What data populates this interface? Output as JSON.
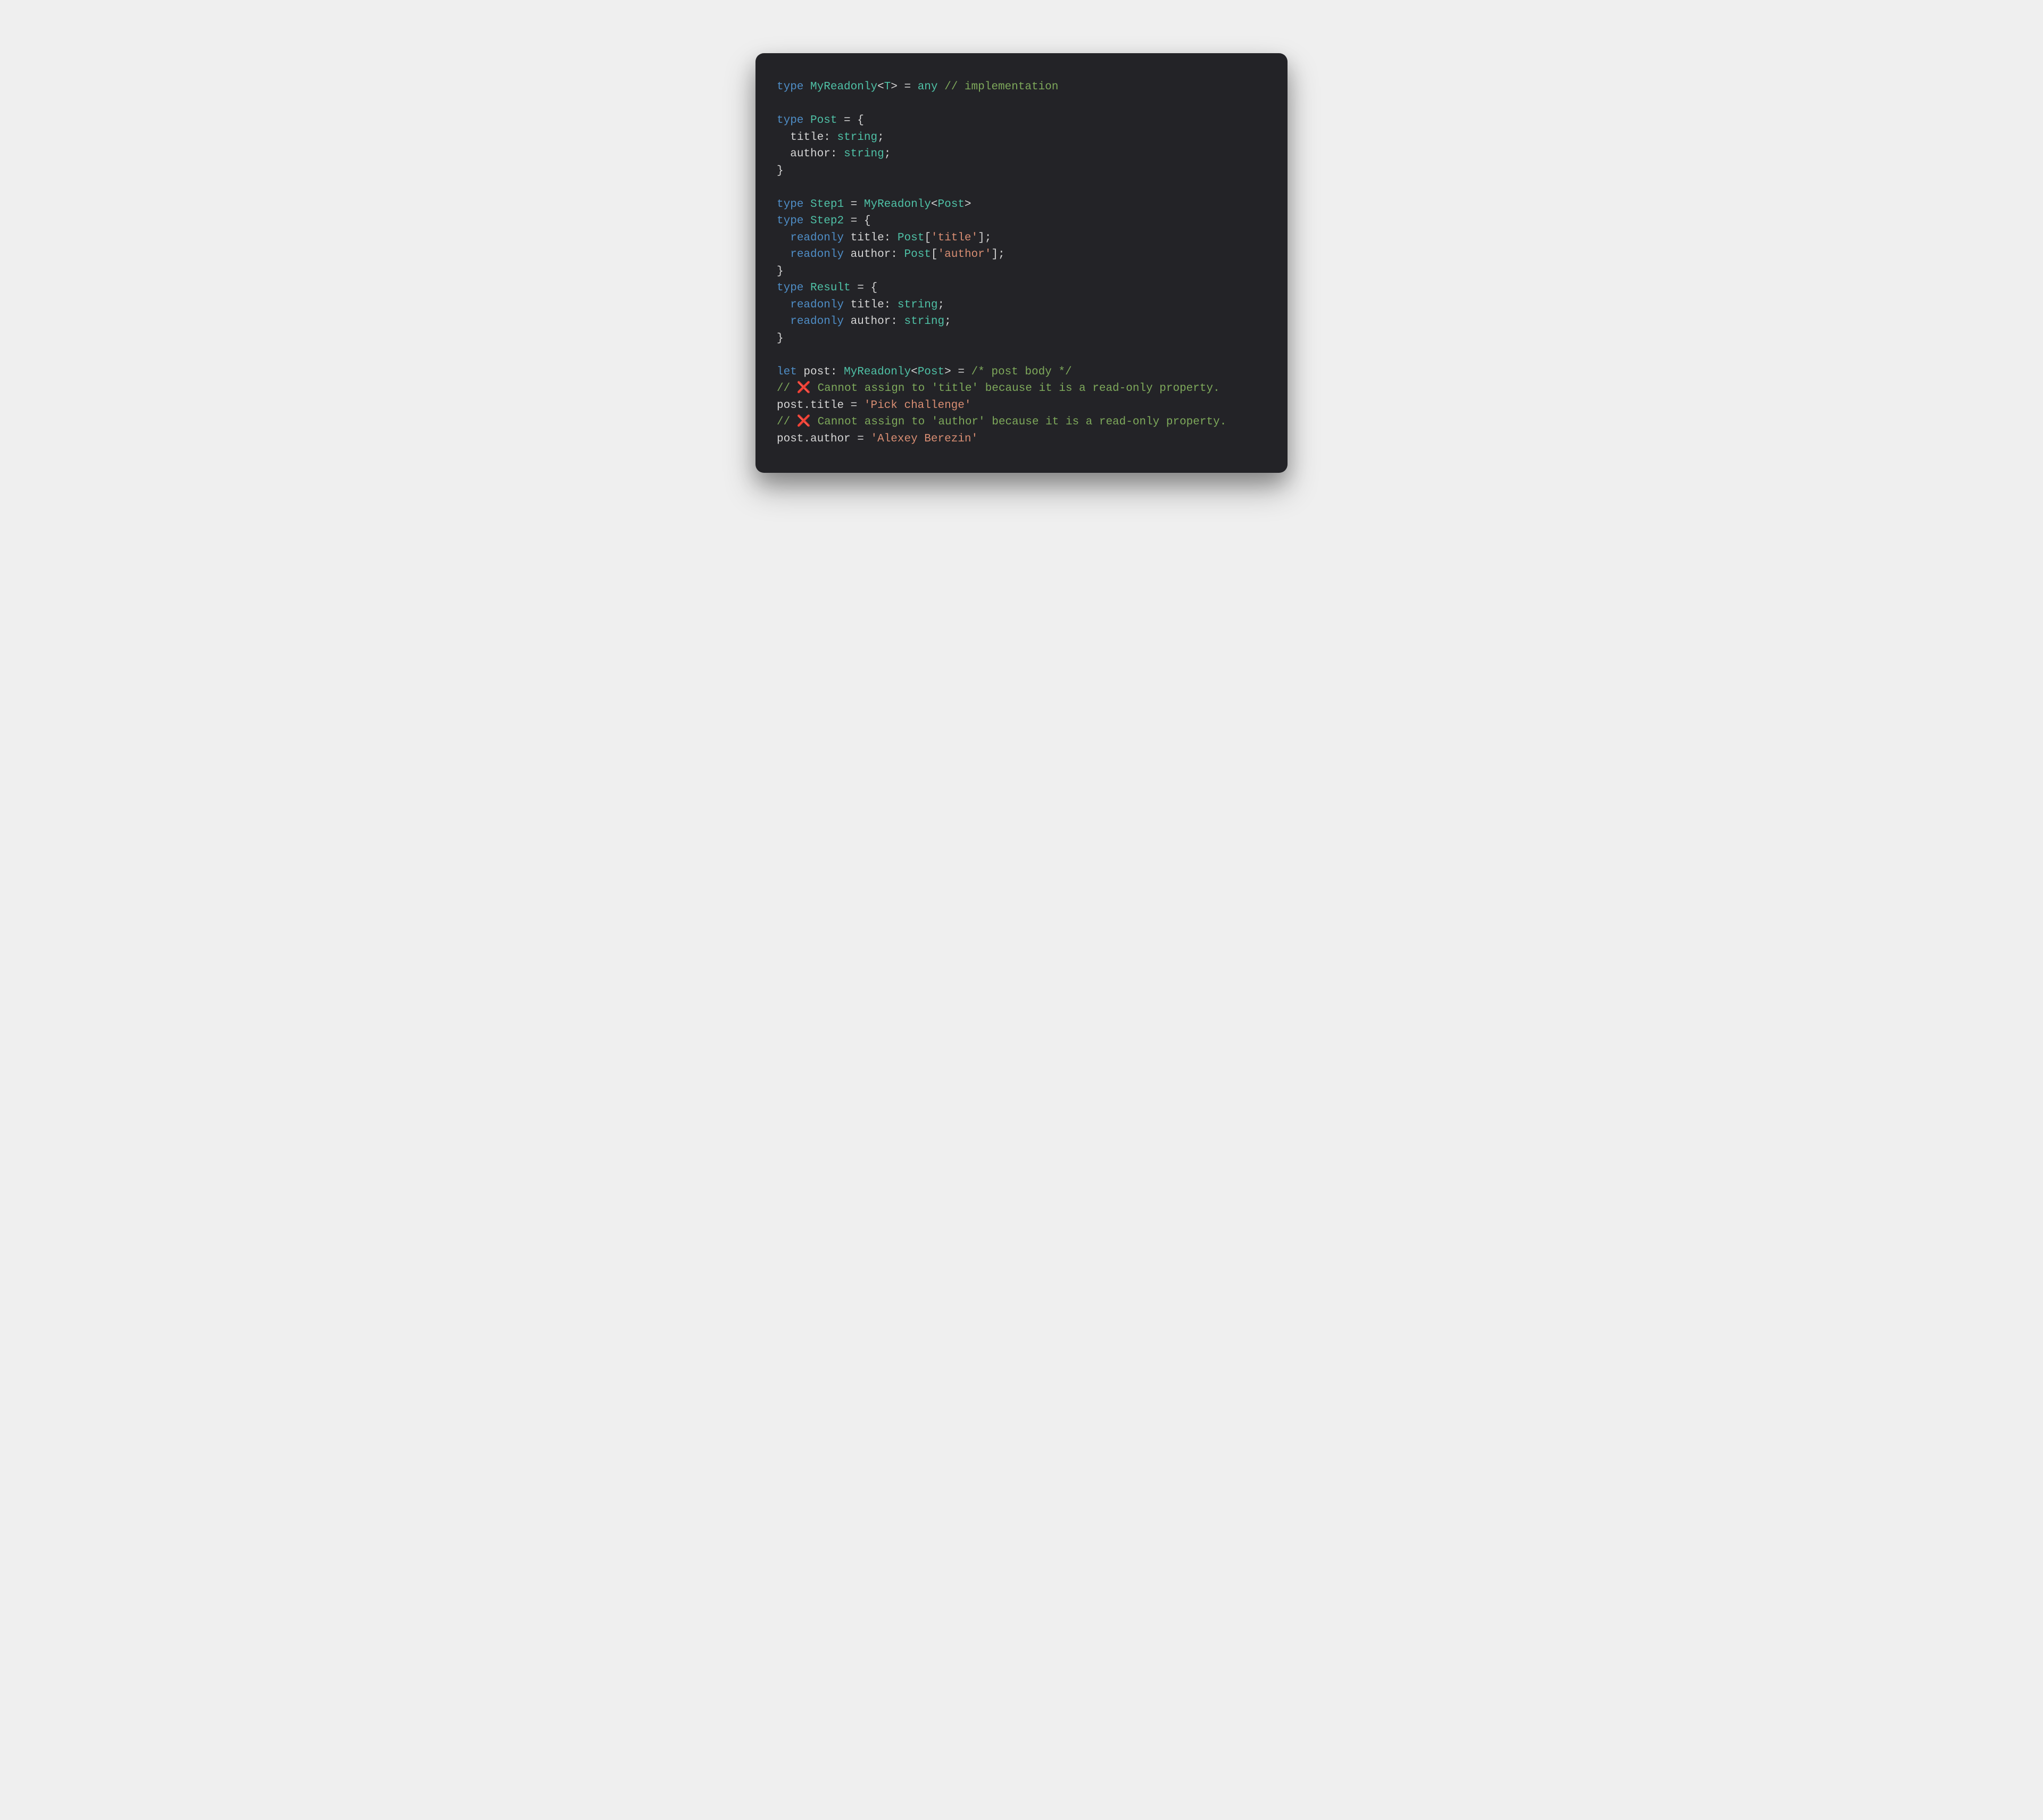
{
  "colors": {
    "background_page": "#efefef",
    "background_card": "#232327",
    "keyword": "#4f8ec7",
    "type": "#4fc1a6",
    "identifier": "#d6d6d6",
    "punctuation": "#d6d6d6",
    "string": "#d98e73",
    "comment": "#7ea95b",
    "error_icon": "#ff3b30"
  },
  "lines": {
    "l01": {
      "kw_type": "type",
      "name": "MyReadonly",
      "lt": "<",
      "param": "T",
      "gt": ">",
      "eq": " = ",
      "any": "any",
      "sp": " ",
      "com": "// implementation"
    },
    "l03": {
      "kw_type": "type",
      "name": "Post",
      "eq": " = {"
    },
    "l04": {
      "indent": "  ",
      "prop": "title",
      "colon": ": ",
      "ptype": "string",
      "semi": ";"
    },
    "l05": {
      "indent": "  ",
      "prop": "author",
      "colon": ": ",
      "ptype": "string",
      "semi": ";"
    },
    "l06": {
      "close": "}"
    },
    "l08": {
      "kw_type": "type",
      "name": "Step1",
      "eq": " = ",
      "ref": "MyReadonly",
      "lt": "<",
      "arg": "Post",
      "gt": ">"
    },
    "l09": {
      "kw_type": "type",
      "name": "Step2",
      "eq": " = {"
    },
    "l10": {
      "indent": "  ",
      "kw_ro": "readonly",
      "sp": " ",
      "prop": "title",
      "colon": ": ",
      "ref": "Post",
      "lb": "[",
      "key": "'title'",
      "rb": "]",
      "semi": ";"
    },
    "l11": {
      "indent": "  ",
      "kw_ro": "readonly",
      "sp": " ",
      "prop": "author",
      "colon": ": ",
      "ref": "Post",
      "lb": "[",
      "key": "'author'",
      "rb": "]",
      "semi": ";"
    },
    "l12": {
      "close": "}"
    },
    "l13": {
      "kw_type": "type",
      "name": "Result",
      "eq": " = {"
    },
    "l14": {
      "indent": "  ",
      "kw_ro": "readonly",
      "sp": " ",
      "prop": "title",
      "colon": ": ",
      "ptype": "string",
      "semi": ";"
    },
    "l15": {
      "indent": "  ",
      "kw_ro": "readonly",
      "sp": " ",
      "prop": "author",
      "colon": ": ",
      "ptype": "string",
      "semi": ";"
    },
    "l16": {
      "close": "}"
    },
    "l18": {
      "kw_let": "let",
      "sp": " ",
      "var": "post",
      "colon": ": ",
      "ref": "MyReadonly",
      "lt": "<",
      "arg": "Post",
      "gt": ">",
      "eq": " = ",
      "com": "/* post body */"
    },
    "l19": {
      "com_pre": "// ",
      "cross": "❌",
      "com_post": " Cannot assign to 'title' because it is a read-only property."
    },
    "l20": {
      "obj": "post",
      "dot": ".",
      "prop": "title",
      "eq": " = ",
      "str": "'Pick challenge'"
    },
    "l21": {
      "com_pre": "// ",
      "cross": "❌",
      "com_post": " Cannot assign to 'author' because it is a read-only property."
    },
    "l22": {
      "obj": "post",
      "dot": ".",
      "prop": "author",
      "eq": " = ",
      "str": "'Alexey Berezin'"
    }
  }
}
